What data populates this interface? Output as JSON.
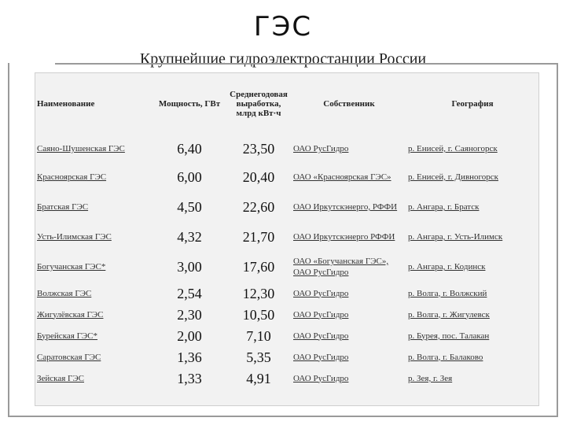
{
  "slide": {
    "title": "ГЭС",
    "subtitle": "Крупнейшие гидроэлектростанции России"
  },
  "table": {
    "headers": {
      "name": "Наименование",
      "power": "Мощность, ГВт",
      "output": "Среднегодовая выработка, млрд кВт·ч",
      "owner": "Собственник",
      "geo": "География"
    },
    "rows": [
      {
        "name": "Саяно-Шушенская ГЭС",
        "power": "6,40",
        "output": "23,50",
        "owner": "ОАО РусГидро",
        "geo": "р. Енисей, г. Саяногорск"
      },
      {
        "name": "Красноярская ГЭС",
        "power": "6,00",
        "output": "20,40",
        "owner": "ОАО «Красноярская ГЭС»",
        "geo": "р. Енисей, г. Дивногорск"
      },
      {
        "name": "Братская ГЭС",
        "power": "4,50",
        "output": "22,60",
        "owner": "ОАО Иркутскэнерго, РФФИ",
        "geo": "р. Ангара, г. Братск"
      },
      {
        "name": "Усть-Илимская ГЭС",
        "power": "4,32",
        "output": "21,70",
        "owner": "ОАО Иркутскэнерго РФФИ",
        "geo": "р. Ангара, г. Усть-Илимск"
      },
      {
        "name": "Богучанская ГЭС*",
        "power": "3,00",
        "output": "17,60",
        "owner": "ОАО «Богучанская ГЭС», ОАО РусГидро",
        "geo": "р. Ангара, г. Кодинск"
      },
      {
        "name": "Волжская ГЭС",
        "power": "2,54",
        "output": "12,30",
        "owner": "ОАО РусГидро",
        "geo": "р. Волга, г. Волжский"
      },
      {
        "name": "Жигулёвская ГЭС",
        "power": "2,30",
        "output": "10,50",
        "owner": "ОАО РусГидро",
        "geo": "р. Волга, г. Жигулевск"
      },
      {
        "name": "Бурейская ГЭС*",
        "power": "2,00",
        "output": "7,10",
        "owner": "ОАО РусГидро",
        "geo": "р. Бурея, пос. Талакан"
      },
      {
        "name": "Саратовская ГЭС",
        "power": "1,36",
        "output": "5,35",
        "owner": "ОАО РусГидро",
        "geo": "р. Волга, г. Балаково"
      },
      {
        "name": "Зейская ГЭС",
        "power": "1,33",
        "output": "4,91",
        "owner": "ОАО РусГидро",
        "geo": "р. Зея, г. Зея"
      }
    ]
  }
}
